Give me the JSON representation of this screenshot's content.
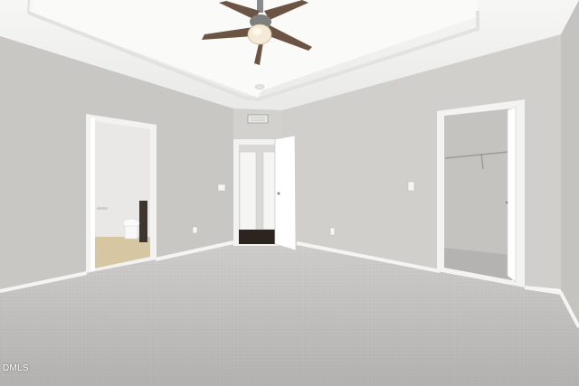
{
  "scene": {
    "description_free": true,
    "watermark": "DMLS"
  },
  "colors": {
    "ceiling": "#f3f3f2",
    "wall_left": "#c9c8c5",
    "wall_back": "#d3d2cf",
    "wall_right": "#cfcecb",
    "carpet": "#bdbbb9",
    "trim": "#f7f7f5",
    "door": "#f4f4f2",
    "fan_blade": "#6b5443",
    "fan_light": "#f4ead6"
  }
}
